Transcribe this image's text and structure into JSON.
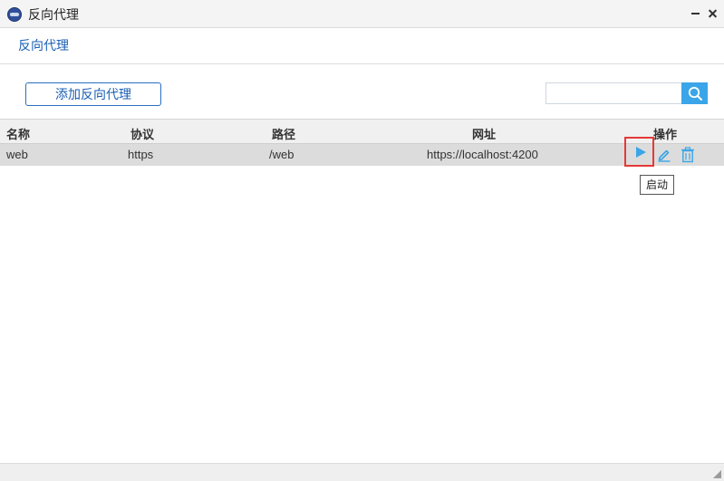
{
  "window": {
    "title": "反向代理",
    "icon": "app-logo-icon"
  },
  "page": {
    "heading": "反向代理"
  },
  "toolbar": {
    "add_label": "添加反向代理",
    "search_placeholder": "",
    "search_icon": "search-icon"
  },
  "table": {
    "headers": {
      "name": "名称",
      "protocol": "协议",
      "path": "路径",
      "url": "网址",
      "actions": "操作"
    },
    "rows": [
      {
        "name": "web",
        "protocol": "https",
        "path": "/web",
        "url": "https://localhost:4200"
      }
    ],
    "action_icons": [
      "play-icon",
      "edit-icon",
      "trash-icon"
    ]
  },
  "tooltip": {
    "text": "启动"
  },
  "colors": {
    "accent": "#3aa5e8",
    "link": "#1a5fb4",
    "highlight": "#e53935",
    "row_bg": "#dcdcdc"
  }
}
